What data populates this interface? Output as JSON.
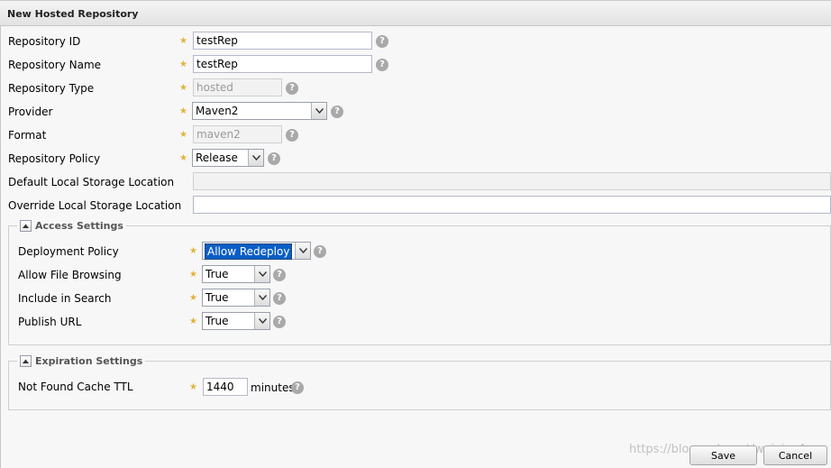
{
  "dialog": {
    "title": "New Hosted Repository"
  },
  "fields": {
    "repository_id": {
      "label": "Repository ID",
      "value": "testRep"
    },
    "repository_name": {
      "label": "Repository Name",
      "value": "testRep"
    },
    "repository_type": {
      "label": "Repository Type",
      "value": "hosted"
    },
    "provider": {
      "label": "Provider",
      "value": "Maven2"
    },
    "format": {
      "label": "Format",
      "value": "maven2"
    },
    "repository_policy": {
      "label": "Repository Policy",
      "value": "Release"
    },
    "default_storage": {
      "label": "Default Local Storage Location",
      "value": ""
    },
    "override_storage": {
      "label": "Override Local Storage Location",
      "value": ""
    }
  },
  "access_settings": {
    "title": "Access Settings",
    "deployment_policy": {
      "label": "Deployment Policy",
      "value": "Allow Redeploy"
    },
    "allow_file_browsing": {
      "label": "Allow File Browsing",
      "value": "True"
    },
    "include_in_search": {
      "label": "Include in Search",
      "value": "True"
    },
    "publish_url": {
      "label": "Publish URL",
      "value": "True"
    }
  },
  "expiration_settings": {
    "title": "Expiration Settings",
    "not_found_cache_ttl": {
      "label": "Not Found Cache TTL",
      "value": "1440",
      "unit": "minutes"
    }
  },
  "buttons": {
    "save": "Save",
    "cancel": "Cancel"
  },
  "watermark": "https://blog.csdn.net/weixin_4...",
  "colors": {
    "required_star": "#e2b23a",
    "selection": "#0a5ec7",
    "help_icon": "#a9a9a9"
  },
  "icons": {
    "help": "question-mark-icon",
    "required": "star-icon",
    "dropdown": "chevron-down-icon",
    "collapse": "collapse-arrow-icon"
  }
}
